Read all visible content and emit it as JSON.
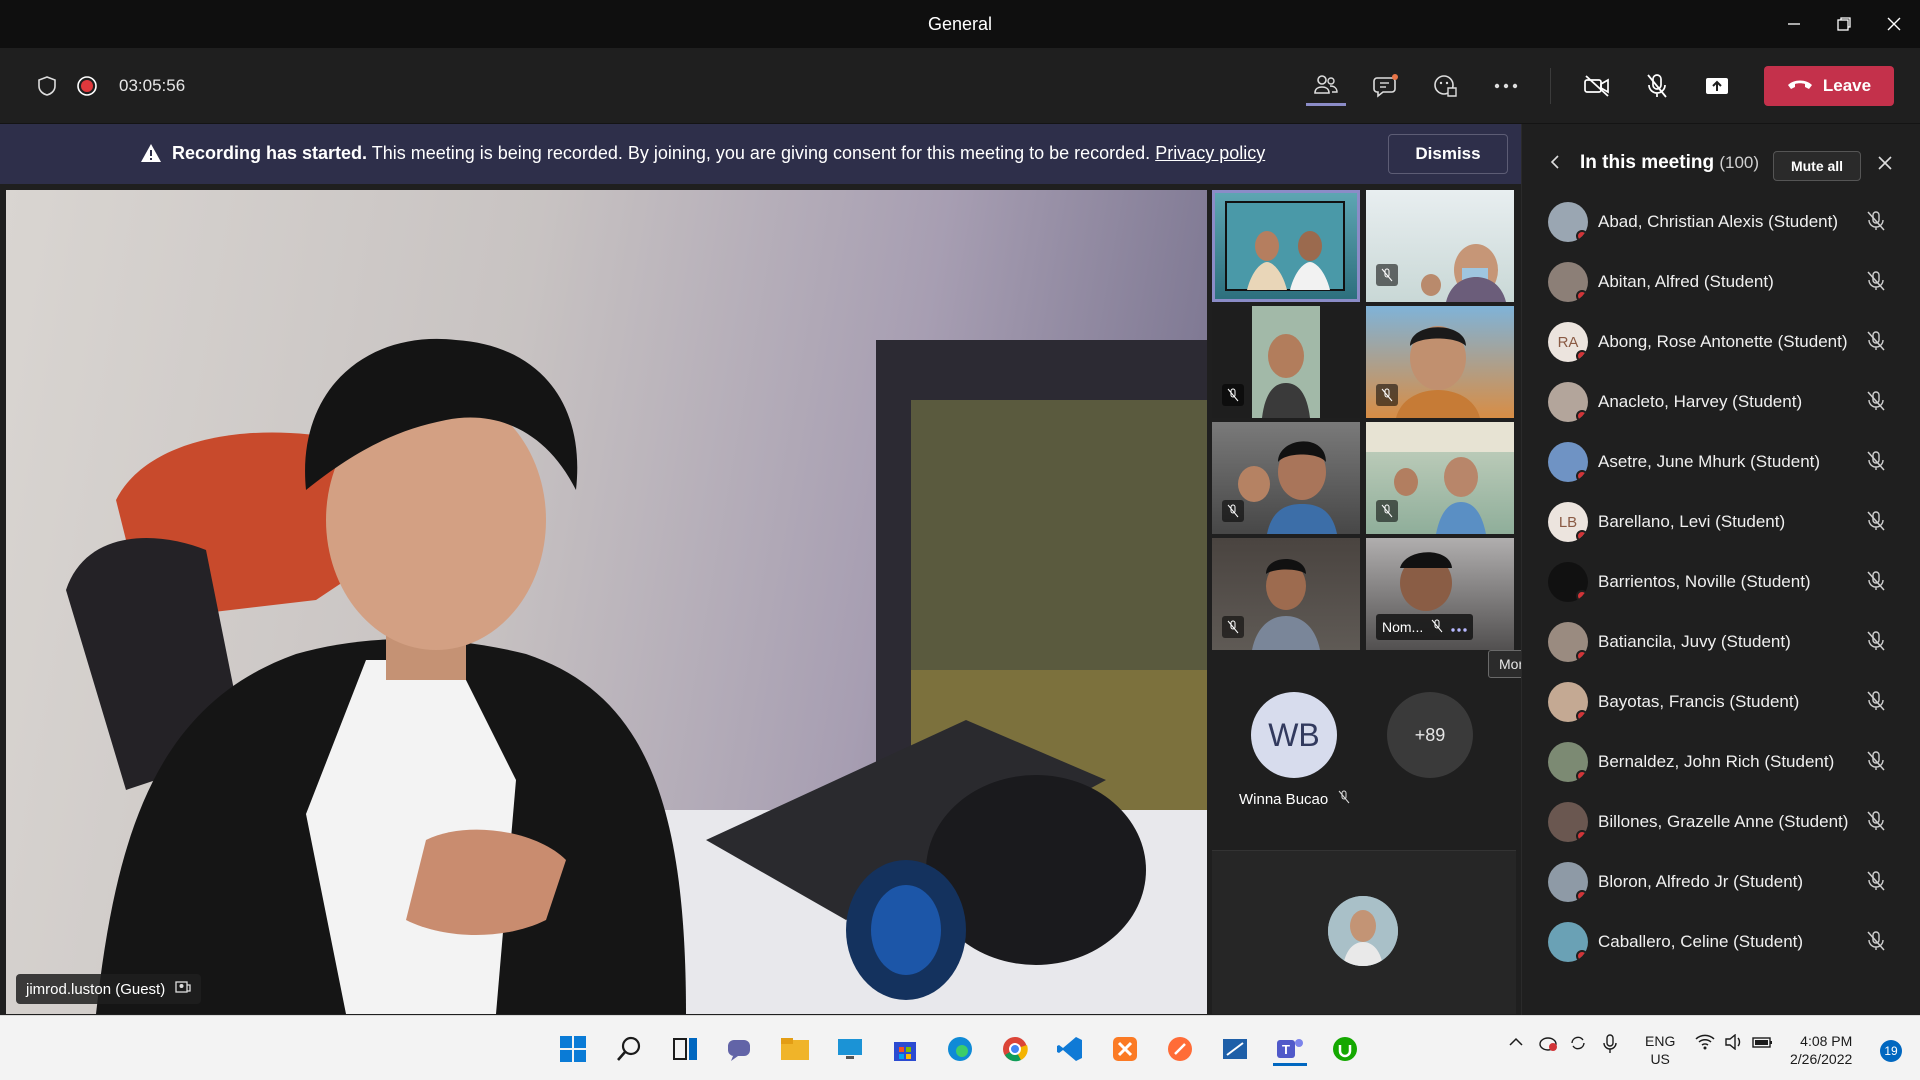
{
  "window": {
    "title": "General"
  },
  "toolbar": {
    "timer": "03:05:56",
    "leave_label": "Leave",
    "icons": [
      "shield-icon",
      "record-icon",
      "people-icon",
      "chat-icon",
      "reactions-icon",
      "more-icon",
      "camera-off-icon",
      "mic-off-icon",
      "share-icon",
      "phone-icon"
    ]
  },
  "banner": {
    "bold": "Recording has started.",
    "text": "This meeting is being recorded. By joining, you are giving consent for this meeting to be recorded.",
    "link": "Privacy policy",
    "dismiss_label": "Dismiss"
  },
  "main_video": {
    "name": "jimrod.luston (Guest)"
  },
  "gallery": {
    "tile8_name": "Nom...",
    "tooltip": "More options",
    "wb_initials": "WB",
    "wb_name": "Winna Bucao",
    "overflow": "+89"
  },
  "panel": {
    "title": "In this meeting",
    "count": "(100)",
    "mute_all": "Mute all",
    "participants": [
      {
        "name": "Abad, Christian Alexis (Student)",
        "initials": ""
      },
      {
        "name": "Abitan, Alfred (Student)",
        "initials": ""
      },
      {
        "name": "Abong, Rose Antonette (Student)",
        "initials": "RA"
      },
      {
        "name": "Anacleto, Harvey (Student)",
        "initials": ""
      },
      {
        "name": "Asetre, June Mhurk (Student)",
        "initials": ""
      },
      {
        "name": "Barellano, Levi (Student)",
        "initials": "LB"
      },
      {
        "name": "Barrientos, Noville (Student)",
        "initials": ""
      },
      {
        "name": "Batiancila, Juvy (Student)",
        "initials": ""
      },
      {
        "name": "Bayotas, Francis (Student)",
        "initials": ""
      },
      {
        "name": "Bernaldez, John Rich (Student)",
        "initials": ""
      },
      {
        "name": "Billones, Grazelle Anne (Student)",
        "initials": ""
      },
      {
        "name": "Bloron, Alfredo Jr (Student)",
        "initials": ""
      },
      {
        "name": "Caballero, Celine (Student)",
        "initials": ""
      }
    ]
  },
  "taskbar": {
    "lang_top": "ENG",
    "lang_bottom": "US",
    "time": "4:08 PM",
    "date": "2/26/2022",
    "notifications": "19"
  },
  "colors": {
    "leave": "#c4314b",
    "banner": "#2e2f4a",
    "accent": "#8b8cc7",
    "status_busy": "#d13438"
  }
}
